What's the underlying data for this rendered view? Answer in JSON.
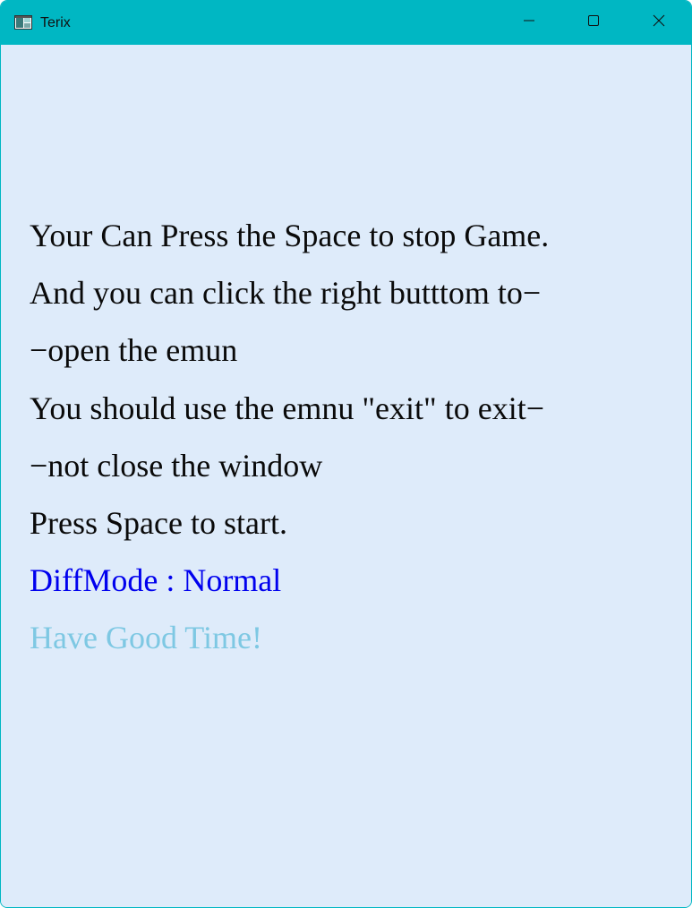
{
  "window": {
    "title": "Terix",
    "icon": "app-window-icon",
    "controls": {
      "minimize_icon": "minimize-icon",
      "maximize_icon": "maximize-icon",
      "close_icon": "close-icon"
    },
    "colors": {
      "titlebar": "#00b7c3",
      "background": "#deebfa"
    }
  },
  "instructions": {
    "lines": [
      "Your Can Press the Space to stop Game.",
      "And you can click the right butttom to−",
      "−open the emun",
      "You should use the emnu \"exit\" to exit−",
      "−not close the window",
      "Press Space to start."
    ],
    "color": "#0a0a0a"
  },
  "difficulty": {
    "text": "DiffMode : Normal",
    "color": "#0000ee"
  },
  "greeting": {
    "text": "Have Good Time!",
    "color": "#7ec8e3"
  }
}
